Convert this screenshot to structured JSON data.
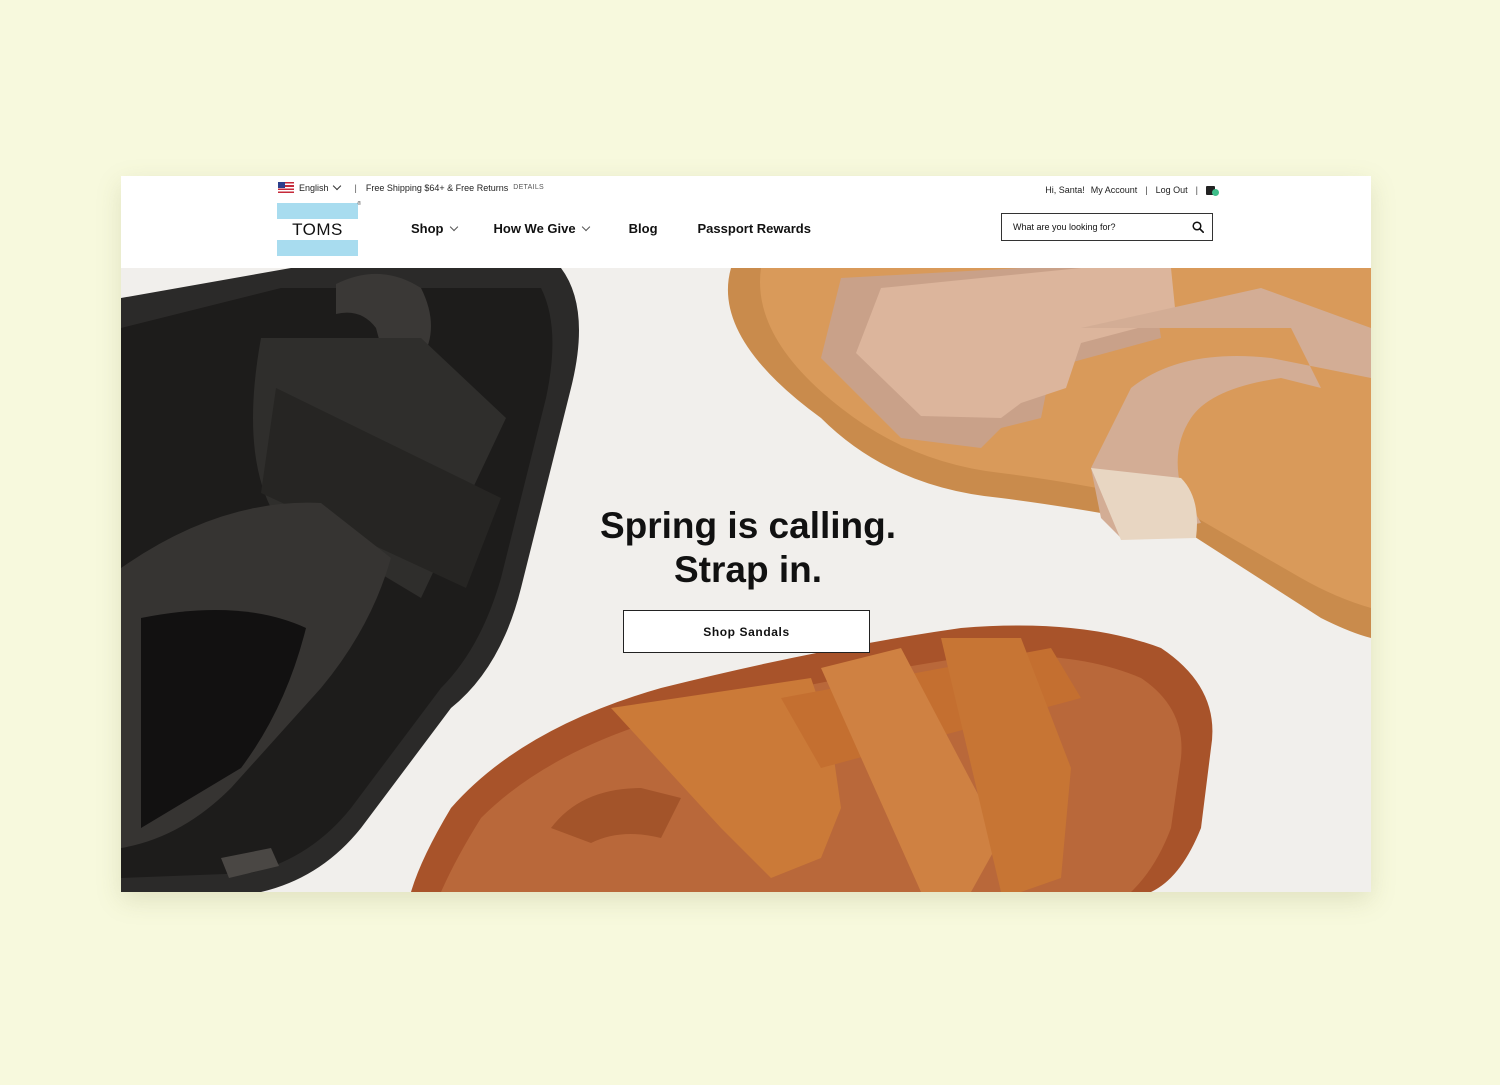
{
  "locale": {
    "language": "English",
    "flag_icon": "us-flag-icon"
  },
  "promo": {
    "text": "Free Shipping $64+ & Free Returns",
    "details_link": "DETAILS"
  },
  "account": {
    "greeting": "Hi, Santa!",
    "my_account": "My Account",
    "log_out": "Log Out",
    "cart_icon": "shopping-bag-icon"
  },
  "logo": {
    "text": "TOMS",
    "trademark": "®"
  },
  "nav": {
    "items": [
      {
        "label": "Shop",
        "has_dropdown": true
      },
      {
        "label": "How We Give",
        "has_dropdown": true
      },
      {
        "label": "Blog",
        "has_dropdown": false
      },
      {
        "label": "Passport Rewards",
        "has_dropdown": false
      }
    ]
  },
  "search": {
    "placeholder": "What are you looking for?",
    "icon": "search-icon"
  },
  "hero": {
    "headline_line1": "Spring is calling.",
    "headline_line2": "Strap in.",
    "cta_label": "Shop Sandals"
  },
  "colors": {
    "page_background": "#f7f9dd",
    "hero_background": "#f1efec",
    "logo_stripe": "#a8dcef",
    "cart_badge": "#3fbf8a"
  }
}
